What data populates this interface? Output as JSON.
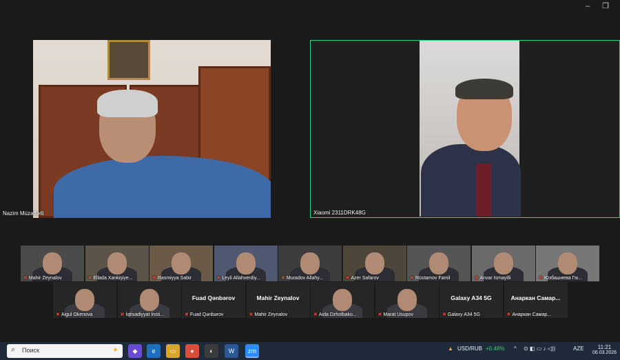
{
  "window": {
    "minimize_icon": "minimize-icon",
    "restore_icon": "restore-icon"
  },
  "speakers": [
    {
      "name": "Nazim Müzəffərli"
    },
    {
      "name": "Xiaomi 2311DRK48G"
    }
  ],
  "gallery_row1": [
    {
      "name": "Mahir Zeynalov"
    },
    {
      "name": "Ellada Xankişiye..."
    },
    {
      "name": "Rasmiyya Sabir"
    },
    {
      "name": "Leyli Allahverdiy..."
    },
    {
      "name": "Muradov Allahy..."
    },
    {
      "name": "Azer Safarov"
    },
    {
      "name": "Rüstamov Famil"
    },
    {
      "name": "Anvar Ismayilli"
    },
    {
      "name": "Юзбашиева Гю..."
    }
  ],
  "gallery_row2": [
    {
      "name": "Aigul Okenova",
      "display": ""
    },
    {
      "name": "İqtisadiyyat İnsti...",
      "display": ""
    },
    {
      "name": "Fuad Qənbərov",
      "display": "Fuad Qənbərov"
    },
    {
      "name": "Mahir Zeynalov",
      "display": "Mahir Zeynalov"
    },
    {
      "name": "Aida Dzholbako...",
      "display": ""
    },
    {
      "name": "Marat Usupov",
      "display": ""
    },
    {
      "name": "Galaxy A34 5G",
      "display": "Galaxy A34 5G"
    },
    {
      "name": "Анаркан Самар...",
      "display": "Анаркан Самар..."
    }
  ],
  "taskbar": {
    "search_placeholder": "Поиск",
    "ticker": "USD/RUB",
    "ticker_change": "+0.48%",
    "language": "AZE",
    "time": "11:21",
    "date": "06.03.2026"
  },
  "colors": {
    "active_speaker_border": "#2fd47f",
    "muted_mic": "#e0403a",
    "ticker_up": "#3ecf6e"
  }
}
